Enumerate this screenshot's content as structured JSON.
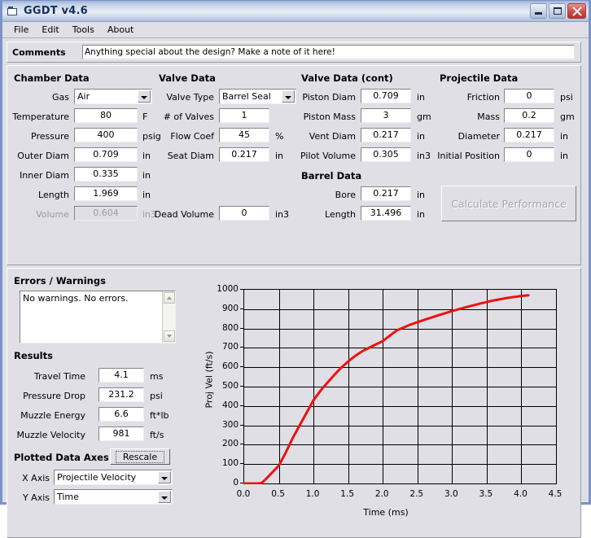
{
  "window": {
    "title": "GGDT v4.6",
    "icon": "app-folder-icon",
    "buttons": {
      "minimize": "minimize-icon",
      "maximize": "maximize-icon",
      "close": "close-icon"
    }
  },
  "menu": {
    "items": [
      "File",
      "Edit",
      "Tools",
      "About"
    ]
  },
  "comments": {
    "label": "Comments",
    "value": "Anything special about the design?  Make a note of it here!"
  },
  "chamber": {
    "title": "Chamber Data",
    "fields": [
      {
        "label": "Gas",
        "value": "Air",
        "unit": "",
        "type": "combo"
      },
      {
        "label": "Temperature",
        "value": "80",
        "unit": "F",
        "type": "text"
      },
      {
        "label": "Pressure",
        "value": "400",
        "unit": "psig",
        "type": "text"
      },
      {
        "label": "Outer Diam",
        "value": "0.709",
        "unit": "in",
        "type": "text"
      },
      {
        "label": "Inner Diam",
        "value": "0.335",
        "unit": "in",
        "type": "text"
      },
      {
        "label": "Length",
        "value": "1.969",
        "unit": "in",
        "type": "text"
      },
      {
        "label": "Volume",
        "value": "0.604",
        "unit": "in3",
        "type": "text",
        "disabled": true
      }
    ]
  },
  "valve": {
    "title": "Valve Data",
    "fields": [
      {
        "label": "Valve Type",
        "value": "Barrel Seal",
        "unit": "",
        "type": "combo"
      },
      {
        "label": "# of Valves",
        "value": "1",
        "unit": "",
        "type": "text"
      },
      {
        "label": "Flow Coef",
        "value": "45",
        "unit": "%",
        "type": "text"
      },
      {
        "label": "Seat Diam",
        "value": "0.217",
        "unit": "in",
        "type": "text"
      },
      {
        "label": "Dead Volume",
        "value": "0",
        "unit": "in3",
        "type": "text"
      }
    ]
  },
  "valve_cont": {
    "title": "Valve Data (cont)",
    "fields": [
      {
        "label": "Piston Diam",
        "value": "0.709",
        "unit": "in"
      },
      {
        "label": "Piston Mass",
        "value": "3",
        "unit": "gm"
      },
      {
        "label": "Vent Diam",
        "value": "0.217",
        "unit": "in"
      },
      {
        "label": "Pilot Volume",
        "value": "0.305",
        "unit": "in3"
      }
    ]
  },
  "barrel": {
    "title": "Barrel Data",
    "fields": [
      {
        "label": "Bore",
        "value": "0.217",
        "unit": "in"
      },
      {
        "label": "Length",
        "value": "31.496",
        "unit": "in"
      }
    ]
  },
  "projectile": {
    "title": "Projectile Data",
    "fields": [
      {
        "label": "Friction",
        "value": "0",
        "unit": "psi"
      },
      {
        "label": "Mass",
        "value": "0.2",
        "unit": "gm"
      },
      {
        "label": "Diameter",
        "value": "0.217",
        "unit": "in"
      },
      {
        "label": "Initial Position",
        "value": "0",
        "unit": "in"
      }
    ],
    "calculate_button": "Calculate Performance"
  },
  "errors": {
    "title": "Errors / Warnings",
    "text": "No warnings.  No errors."
  },
  "results": {
    "title": "Results",
    "fields": [
      {
        "label": "Travel Time",
        "value": "4.1",
        "unit": "ms"
      },
      {
        "label": "Pressure Drop",
        "value": "231.2",
        "unit": "psi"
      },
      {
        "label": "Muzzle Energy",
        "value": "6.6",
        "unit": "ft*lb"
      },
      {
        "label": "Muzzle Velocity",
        "value": "981",
        "unit": "ft/s"
      }
    ]
  },
  "plotted_axes": {
    "title": "Plotted Data Axes",
    "rescale_button": "Rescale",
    "x_axis_label": "X Axis",
    "x_axis_value": "Projectile Velocity",
    "y_axis_label": "Y Axis",
    "y_axis_value": "Time"
  },
  "chart_data": {
    "type": "line",
    "title": "",
    "xlabel": "Time (ms)",
    "ylabel": "Proj Vel (ft/s)",
    "xlim": [
      0.0,
      4.5
    ],
    "ylim": [
      0,
      1000
    ],
    "xticks": [
      "0.0",
      "0.5",
      "1.0",
      "1.5",
      "2.0",
      "2.5",
      "3.0",
      "3.5",
      "4.0",
      "4.5"
    ],
    "yticks": [
      "0",
      "100",
      "200",
      "300",
      "400",
      "500",
      "600",
      "700",
      "800",
      "900",
      "1000"
    ],
    "grid": true,
    "legend": "none",
    "line_color": "#ee1111",
    "series": [
      {
        "name": "Projectile Velocity",
        "x": [
          0.0,
          0.1,
          0.2,
          0.25,
          0.3,
          0.4,
          0.5,
          0.6,
          0.7,
          0.8,
          0.9,
          1.0,
          1.1,
          1.2,
          1.3,
          1.4,
          1.5,
          1.6,
          1.7,
          1.8,
          1.9,
          2.0,
          2.2,
          2.4,
          2.6,
          2.8,
          3.0,
          3.2,
          3.4,
          3.6,
          3.8,
          4.0,
          4.1
        ],
        "y": [
          0,
          0,
          0,
          2,
          18,
          55,
          93,
          160,
          235,
          300,
          365,
          430,
          478,
          520,
          560,
          598,
          630,
          658,
          682,
          700,
          718,
          735,
          790,
          820,
          845,
          868,
          890,
          910,
          928,
          945,
          958,
          968,
          972
        ]
      }
    ]
  }
}
